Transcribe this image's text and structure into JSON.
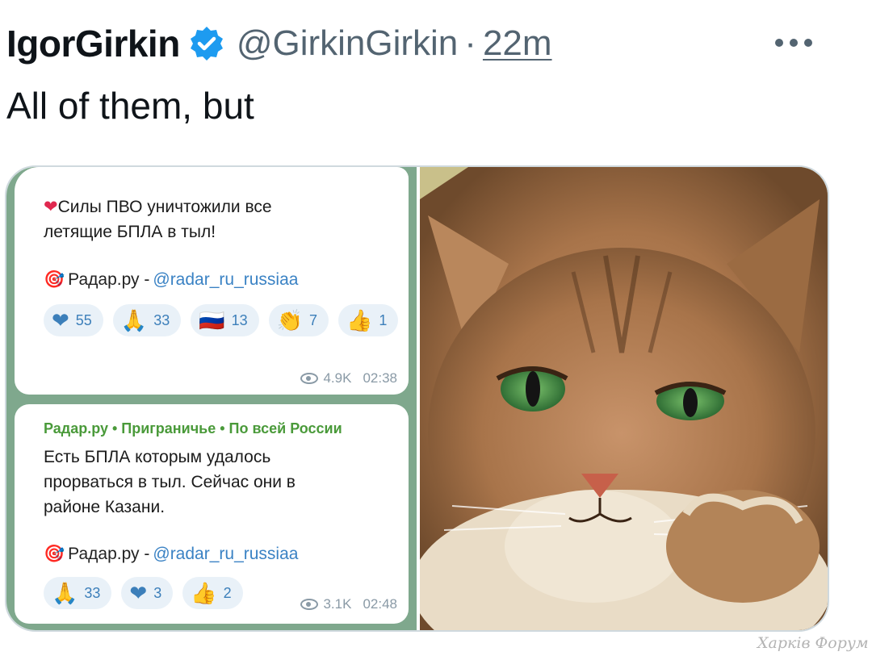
{
  "tweet": {
    "display_name": "IgorGirkin",
    "handle": "@GirkinGirkin",
    "separator": "·",
    "time": "22m",
    "text": "All of them, but",
    "verified_icon": "verified-badge-icon",
    "more_icon": "more-horizontal-icon"
  },
  "media": {
    "telegram": {
      "message1": {
        "text_line1": "Силы ПВО уничтожили все",
        "text_line2": "летящие БПЛА в тыл!",
        "link_name": "Радар.ру - ",
        "link_handle": "@radar_ru_russiaa",
        "reactions": [
          {
            "emoji": "❤",
            "count": "55"
          },
          {
            "emoji": "🙏",
            "count": "33"
          },
          {
            "emoji": "🇷🇺",
            "count": "13"
          },
          {
            "emoji": "👏",
            "count": "7"
          },
          {
            "emoji": "👍",
            "count": "1"
          }
        ],
        "views": "4.9K",
        "time": "02:38"
      },
      "message2": {
        "source": "Радар.ру • Приграничье • По всей России",
        "text_line1": "Есть БПЛА которым удалось",
        "text_line2": "прорваться в тыл. Сейчас они в",
        "text_line3": "районе Казани.",
        "link_name": "Радар.ру - ",
        "link_handle": "@radar_ru_russiaa",
        "reactions": [
          {
            "emoji": "🙏",
            "count": "33"
          },
          {
            "emoji": "❤",
            "count": "3"
          },
          {
            "emoji": "👍",
            "count": "2"
          }
        ],
        "views": "3.1K",
        "time": "02:48"
      }
    },
    "cat_colors": {
      "fur": "#b07a4a",
      "eyes": "#3f8a4a",
      "nose": "#d0705a"
    }
  },
  "watermark": "Харків Форум"
}
